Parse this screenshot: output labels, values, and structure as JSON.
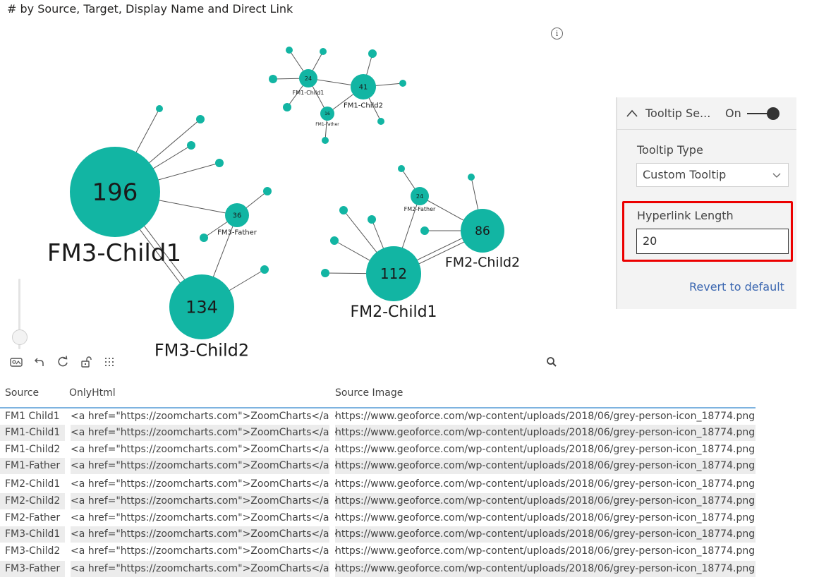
{
  "visual": {
    "title": "# by Source, Target, Display Name and Direct Link"
  },
  "graph": {
    "node_color": "#12b5a3",
    "link_color": "#555555",
    "nodes": [
      {
        "id": "FM3-Child1",
        "value": "196",
        "label": "FM3-Child1"
      },
      {
        "id": "FM3-Child2",
        "value": "134",
        "label": "FM3-Child2"
      },
      {
        "id": "FM3-Father",
        "value": "36",
        "label": "FM3-Father"
      },
      {
        "id": "FM2-Child1",
        "value": "112",
        "label": "FM2-Child1"
      },
      {
        "id": "FM2-Child2",
        "value": "86",
        "label": "FM2-Child2"
      },
      {
        "id": "FM2-Father",
        "value": "24",
        "label": "FM2-Father"
      },
      {
        "id": "FM1-Child1",
        "value": "24",
        "label": "FM1-Child1"
      },
      {
        "id": "FM1-Child2",
        "value": "41",
        "label": "FM1-Child2"
      },
      {
        "id": "FM1-Father",
        "value": "16",
        "label": "FM1-Father"
      }
    ]
  },
  "toolbar": {
    "icons": [
      "chart-export-icon",
      "undo-icon",
      "refresh-icon",
      "unlock-icon",
      "grid-icon"
    ],
    "search_icon": "search-icon",
    "info_icon": "info-icon"
  },
  "format_pane": {
    "section_title": "Tooltip Se...",
    "toggle_label": "On",
    "tooltip_type_label": "Tooltip Type",
    "tooltip_type_value": "Custom Tooltip",
    "hyperlink_length_label": "Hyperlink Length",
    "hyperlink_length_value": "20",
    "revert_label": "Revert to default",
    "highlight_color": "#ec0000"
  },
  "table": {
    "columns": [
      "Source",
      "OnlyHtml",
      "Source Image"
    ],
    "rows": [
      [
        "FM1 Child1",
        "<a href=\"https://zoomcharts.com\">ZoomCharts</a>",
        "https://www.geoforce.com/wp-content/uploads/2018/06/grey-person-icon_18774.png"
      ],
      [
        "FM1-Child1",
        "<a href=\"https://zoomcharts.com\">ZoomCharts</a>",
        "https://www.geoforce.com/wp-content/uploads/2018/06/grey-person-icon_18774.png"
      ],
      [
        "FM1-Child2",
        "<a href=\"https://zoomcharts.com\">ZoomCharts</a>",
        "https://www.geoforce.com/wp-content/uploads/2018/06/grey-person-icon_18774.png"
      ],
      [
        "FM1-Father",
        "<a href=\"https://zoomcharts.com\">ZoomCharts</a>",
        "https://www.geoforce.com/wp-content/uploads/2018/06/grey-person-icon_18774.png"
      ],
      [
        "FM2-Child1",
        "<a href=\"https://zoomcharts.com\">ZoomCharts</a>",
        "https://www.geoforce.com/wp-content/uploads/2018/06/grey-person-icon_18774.png"
      ],
      [
        "FM2-Child2",
        "<a href=\"https://zoomcharts.com\">ZoomCharts</a>",
        "https://www.geoforce.com/wp-content/uploads/2018/06/grey-person-icon_18774.png"
      ],
      [
        "FM2-Father",
        "<a href=\"https://zoomcharts.com\">ZoomCharts</a>",
        "https://www.geoforce.com/wp-content/uploads/2018/06/grey-person-icon_18774.png"
      ],
      [
        "FM3-Child1",
        "<a href=\"https://zoomcharts.com\">ZoomCharts</a>",
        "https://www.geoforce.com/wp-content/uploads/2018/06/grey-person-icon_18774.png"
      ],
      [
        "FM3-Child2",
        "<a href=\"https://zoomcharts.com\">ZoomCharts</a>",
        "https://www.geoforce.com/wp-content/uploads/2018/06/grey-person-icon_18774.png"
      ],
      [
        "FM3-Father",
        "<a href=\"https://zoomcharts.com\">ZoomCharts</a>",
        "https://www.geoforce.com/wp-content/uploads/2018/06/grey-person-icon_18774.png"
      ]
    ]
  }
}
